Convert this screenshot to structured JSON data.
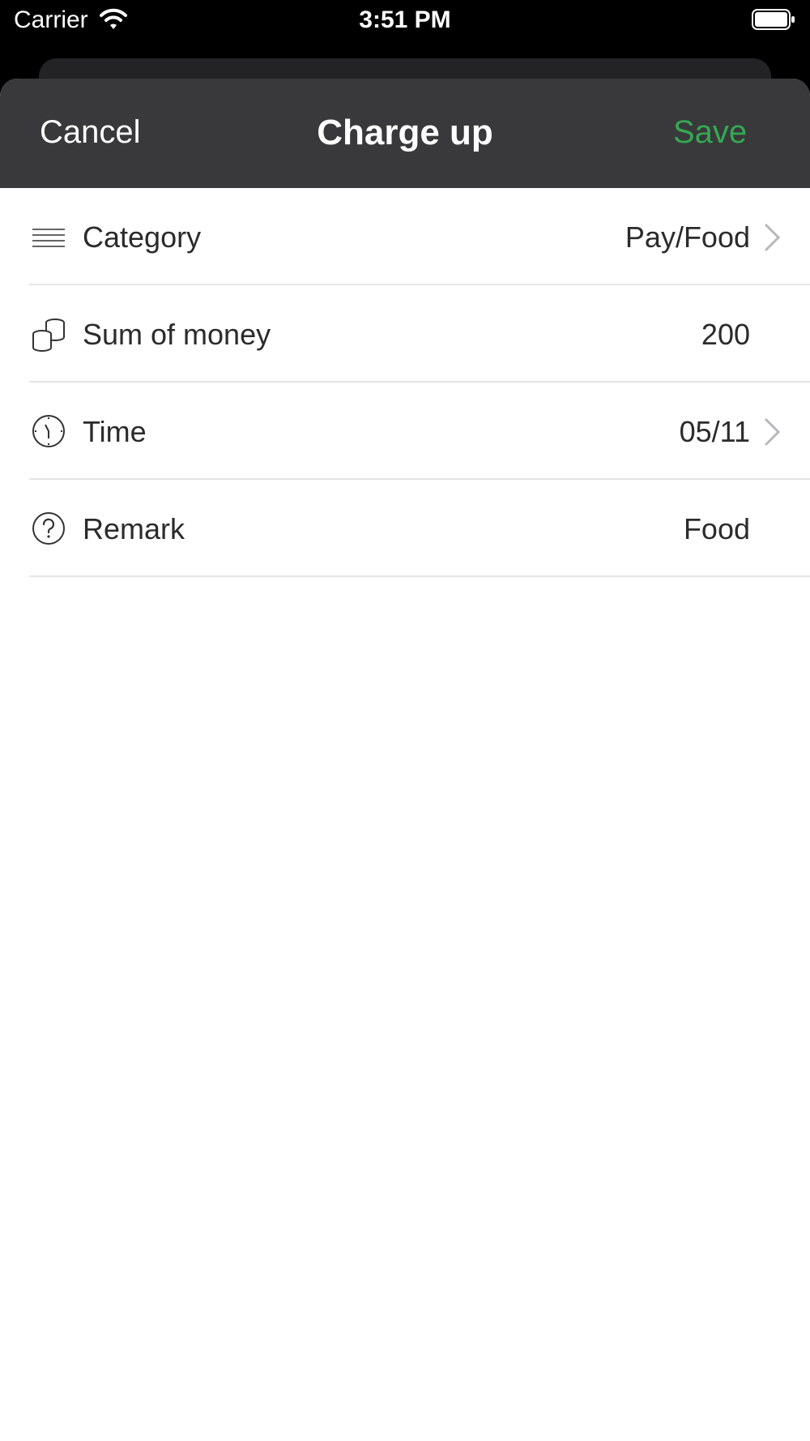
{
  "status_bar": {
    "carrier": "Carrier",
    "time": "3:51 PM"
  },
  "nav": {
    "cancel_label": "Cancel",
    "title": "Charge up",
    "save_label": "Save",
    "save_color": "#34a853"
  },
  "rows": [
    {
      "label": "Category",
      "value": "Pay/Food",
      "icon": "list-icon",
      "has_chevron": true
    },
    {
      "label": "Sum of money",
      "value": "200",
      "icon": "coins-icon",
      "has_chevron": false
    },
    {
      "label": "Time",
      "value": "05/11",
      "icon": "clock-icon",
      "has_chevron": true
    },
    {
      "label": "Remark",
      "value": "Food",
      "icon": "question-icon",
      "has_chevron": false
    }
  ]
}
